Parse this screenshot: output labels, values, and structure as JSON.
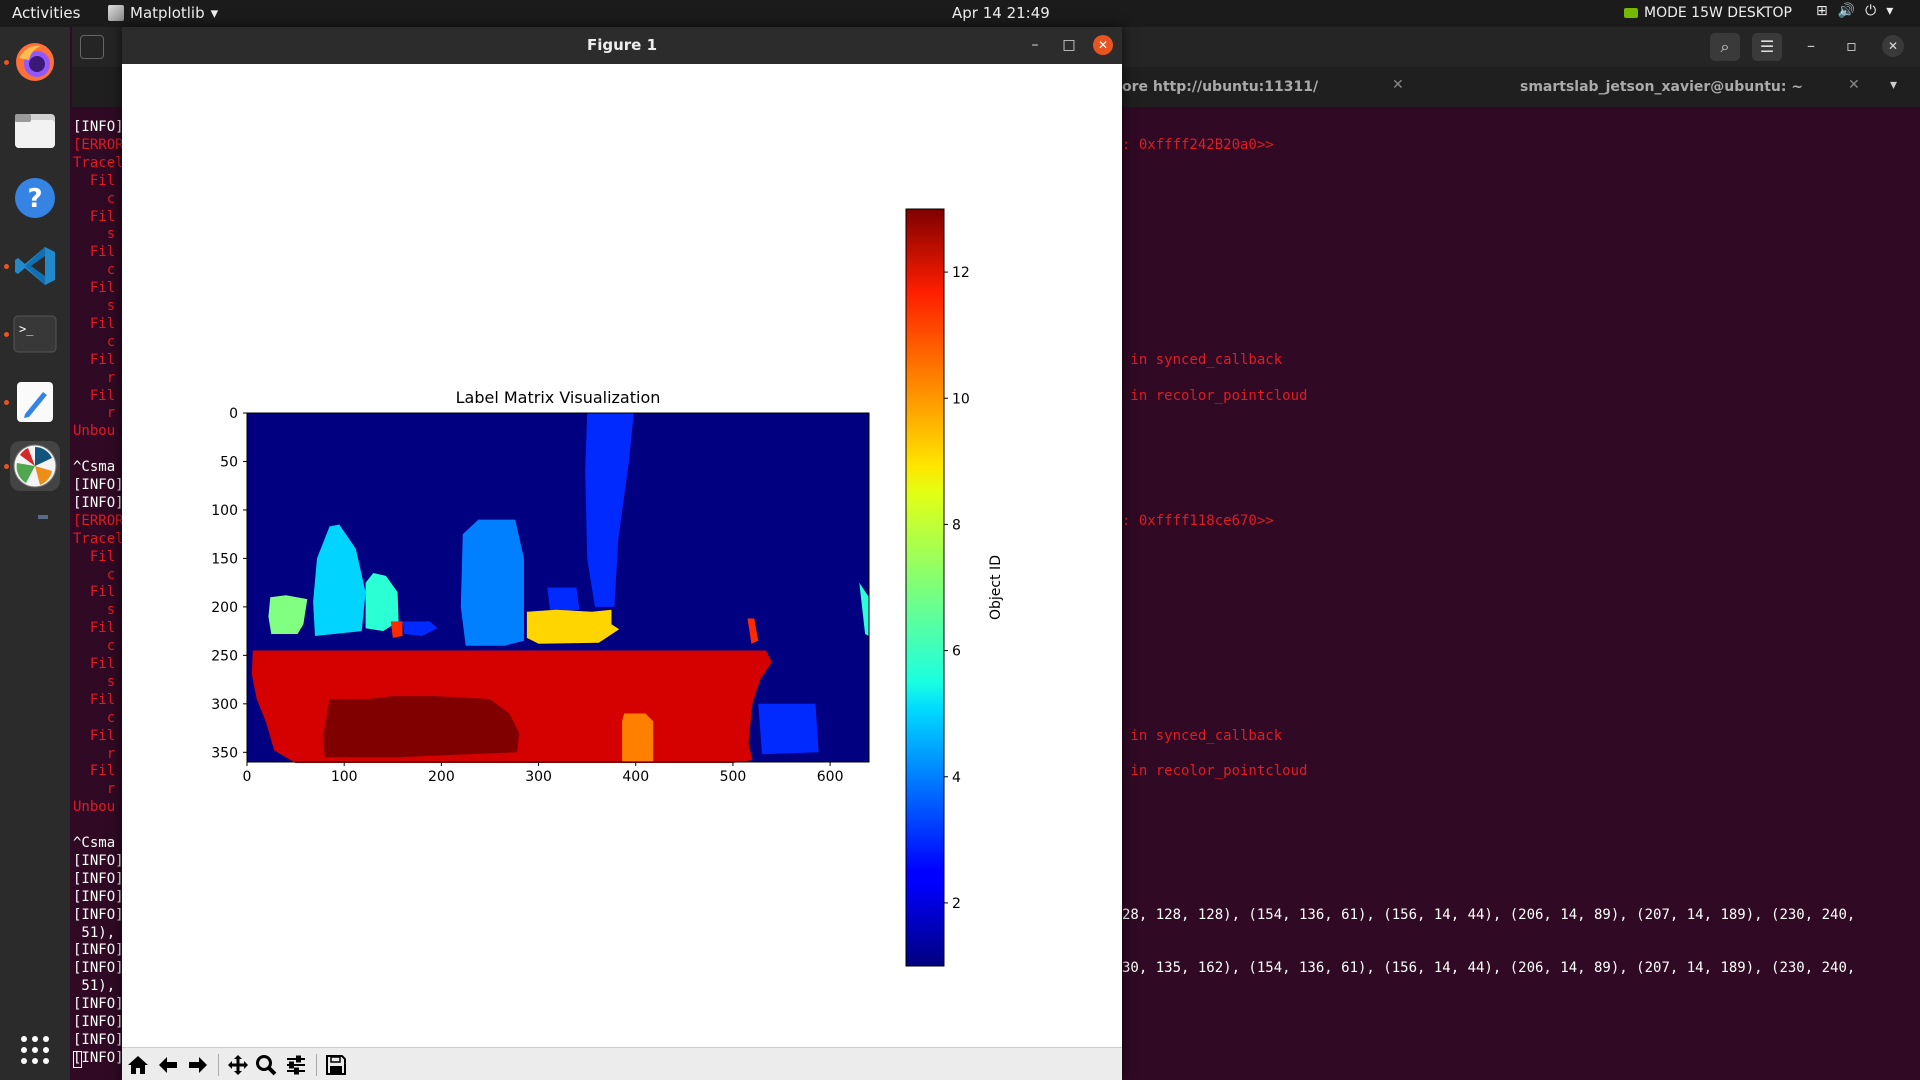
{
  "topbar": {
    "activities": "Activities",
    "app_name": "Matplotlib",
    "clock": "Apr 14  21:49",
    "mode": "MODE 15W DESKTOP"
  },
  "dock": {
    "items": [
      "firefox-icon",
      "files-icon",
      "help-icon",
      "vscode-icon",
      "terminal-icon",
      "text-editor-icon",
      "matplotlib-icon",
      "show-apps-icon"
    ]
  },
  "terminal": {
    "tab1": "ore http://ubuntu:11311/",
    "tab2": "smartslab_jetson_xavier@ubuntu: ~",
    "left_lines": [
      {
        "text": "[INFO]",
        "color": "#ffffff"
      },
      {
        "text": "[ERROR",
        "color": "#e01b24"
      },
      {
        "text": "Tracel",
        "color": "#e01b24"
      },
      {
        "text": "  Fil",
        "color": "#e01b24"
      },
      {
        "text": "    c",
        "color": "#e01b24"
      },
      {
        "text": "  Fil",
        "color": "#e01b24"
      },
      {
        "text": "    s",
        "color": "#e01b24"
      },
      {
        "text": "  Fil",
        "color": "#e01b24"
      },
      {
        "text": "    c",
        "color": "#e01b24"
      },
      {
        "text": "  Fil",
        "color": "#e01b24"
      },
      {
        "text": "    s",
        "color": "#e01b24"
      },
      {
        "text": "  Fil",
        "color": "#e01b24"
      },
      {
        "text": "    c",
        "color": "#e01b24"
      },
      {
        "text": "  Fil",
        "color": "#e01b24"
      },
      {
        "text": "    r",
        "color": "#e01b24"
      },
      {
        "text": "  Fil",
        "color": "#e01b24"
      },
      {
        "text": "    r",
        "color": "#e01b24"
      },
      {
        "text": "Unbou",
        "color": "#e01b24"
      },
      {
        "text": "",
        "color": "#ffffff"
      },
      {
        "text": "^Csma",
        "color": "#ffffff"
      },
      {
        "text": "[INFO]",
        "color": "#ffffff"
      },
      {
        "text": "[INFO]",
        "color": "#ffffff"
      },
      {
        "text": "[ERROR",
        "color": "#e01b24"
      },
      {
        "text": "Tracel",
        "color": "#e01b24"
      },
      {
        "text": "  Fil",
        "color": "#e01b24"
      },
      {
        "text": "    c",
        "color": "#e01b24"
      },
      {
        "text": "  Fil",
        "color": "#e01b24"
      },
      {
        "text": "    s",
        "color": "#e01b24"
      },
      {
        "text": "  Fil",
        "color": "#e01b24"
      },
      {
        "text": "    c",
        "color": "#e01b24"
      },
      {
        "text": "  Fil",
        "color": "#e01b24"
      },
      {
        "text": "    s",
        "color": "#e01b24"
      },
      {
        "text": "  Fil",
        "color": "#e01b24"
      },
      {
        "text": "    c",
        "color": "#e01b24"
      },
      {
        "text": "  Fil",
        "color": "#e01b24"
      },
      {
        "text": "    r",
        "color": "#e01b24"
      },
      {
        "text": "  Fil",
        "color": "#e01b24"
      },
      {
        "text": "    r",
        "color": "#e01b24"
      },
      {
        "text": "Unbou",
        "color": "#e01b24"
      },
      {
        "text": "",
        "color": "#ffffff"
      },
      {
        "text": "^Csma",
        "color": "#ffffff"
      },
      {
        "text": "[INFO]",
        "color": "#ffffff"
      },
      {
        "text": "[INFO]",
        "color": "#ffffff"
      },
      {
        "text": "[INFO]",
        "color": "#ffffff"
      },
      {
        "text": "[INFO]",
        "color": "#ffffff"
      },
      {
        "text": " 51),",
        "color": "#ffffff"
      },
      {
        "text": "[INFO]",
        "color": "#ffffff"
      },
      {
        "text": "[INFO]",
        "color": "#ffffff"
      },
      {
        "text": " 51),",
        "color": "#ffffff"
      },
      {
        "text": "[INFO]",
        "color": "#ffffff"
      },
      {
        "text": "[INFO]",
        "color": "#ffffff"
      },
      {
        "text": "[INFO]",
        "color": "#ffffff"
      },
      {
        "text": "[INFO]",
        "color": "#ffffff"
      }
    ],
    "right_lines": [
      {
        "row": 1,
        "text": ": 0xffff242B20a0>>",
        "color": "#e01b24"
      },
      {
        "row": 13,
        "text": " in synced_callback",
        "color": "#e01b24"
      },
      {
        "row": 15,
        "text": " in recolor_pointcloud",
        "color": "#e01b24"
      },
      {
        "row": 22,
        "text": ": 0xffff118ce670>>",
        "color": "#e01b24"
      },
      {
        "row": 34,
        "text": " in synced_callback",
        "color": "#e01b24"
      },
      {
        "row": 36,
        "text": " in recolor_pointcloud",
        "color": "#e01b24"
      },
      {
        "row": 44,
        "text": "28, 128, 128), (154, 136, 61), (156, 14, 44), (206, 14, 89), (207, 14, 189), (230, 240,",
        "color": "#ffffff"
      },
      {
        "row": 47,
        "text": "30, 135, 162), (154, 136, 61), (156, 14, 44), (206, 14, 89), (207, 14, 189), (230, 240,",
        "color": "#ffffff"
      }
    ]
  },
  "window": {
    "title": "Figure 1",
    "min": "–",
    "max": "□",
    "close": "✕"
  },
  "chart_data": {
    "type": "heatmap",
    "title": "Label Matrix Visualization",
    "xlabel": "",
    "ylabel": "",
    "xlim": [
      0,
      640
    ],
    "ylim": [
      360,
      0
    ],
    "xticks": [
      0,
      100,
      200,
      300,
      400,
      500,
      600
    ],
    "yticks": [
      0,
      50,
      100,
      150,
      200,
      250,
      300,
      350
    ],
    "colormap": "jet",
    "background_value": 1,
    "colorbar": {
      "label": "Object ID",
      "range": [
        1,
        13
      ],
      "ticks": [
        2,
        4,
        6,
        8,
        10,
        12
      ]
    },
    "regions": [
      {
        "value": 3,
        "points": [
          [
            350,
            0
          ],
          [
            398,
            0
          ],
          [
            393,
            50
          ],
          [
            382,
            130
          ],
          [
            378,
            200
          ],
          [
            358,
            200
          ],
          [
            350,
            150
          ],
          [
            348,
            60
          ]
        ]
      },
      {
        "value": 4,
        "points": [
          [
            222,
            125
          ],
          [
            238,
            110
          ],
          [
            276,
            110
          ],
          [
            285,
            150
          ],
          [
            285,
            235
          ],
          [
            265,
            240
          ],
          [
            225,
            240
          ],
          [
            220,
            200
          ]
        ]
      },
      {
        "value": 5,
        "points": [
          [
            72,
            150
          ],
          [
            85,
            117
          ],
          [
            95,
            115
          ],
          [
            112,
            140
          ],
          [
            122,
            185
          ],
          [
            118,
            225
          ],
          [
            70,
            230
          ],
          [
            68,
            195
          ]
        ]
      },
      {
        "value": 7,
        "points": [
          [
            24,
            190
          ],
          [
            40,
            188
          ],
          [
            62,
            192
          ],
          [
            58,
            218
          ],
          [
            52,
            228
          ],
          [
            25,
            228
          ],
          [
            22,
            210
          ]
        ]
      },
      {
        "value": 6,
        "points": [
          [
            122,
            175
          ],
          [
            130,
            165
          ],
          [
            143,
            168
          ],
          [
            155,
            185
          ],
          [
            156,
            215
          ],
          [
            140,
            225
          ],
          [
            122,
            222
          ]
        ]
      },
      {
        "value": 11,
        "points": [
          [
            148,
            215
          ],
          [
            160,
            215
          ],
          [
            160,
            230
          ],
          [
            150,
            232
          ]
        ]
      },
      {
        "value": 3,
        "points": [
          [
            160,
            215
          ],
          [
            188,
            215
          ],
          [
            196,
            222
          ],
          [
            180,
            230
          ],
          [
            162,
            228
          ]
        ]
      },
      {
        "value": 3,
        "points": [
          [
            309,
            180
          ],
          [
            339,
            180
          ],
          [
            342,
            203
          ],
          [
            312,
            205
          ]
        ]
      },
      {
        "value": 9,
        "points": [
          [
            288,
            205
          ],
          [
            318,
            203
          ],
          [
            355,
            205
          ],
          [
            375,
            203
          ],
          [
            375,
            218
          ],
          [
            383,
            223
          ],
          [
            362,
            237
          ],
          [
            300,
            238
          ],
          [
            288,
            232
          ]
        ]
      },
      {
        "value": 11,
        "points": [
          [
            515,
            212
          ],
          [
            522,
            212
          ],
          [
            526,
            235
          ],
          [
            519,
            238
          ]
        ]
      },
      {
        "value": 6,
        "points": [
          [
            630,
            175
          ],
          [
            640,
            190
          ],
          [
            640,
            230
          ],
          [
            636,
            228
          ]
        ]
      },
      {
        "value": 12,
        "points": [
          [
            6,
            245
          ],
          [
            534,
            245
          ],
          [
            540,
            257
          ],
          [
            528,
            275
          ],
          [
            520,
            300
          ],
          [
            516,
            340
          ],
          [
            520,
            358
          ],
          [
            500,
            361
          ],
          [
            428,
            361
          ],
          [
            50,
            361
          ],
          [
            28,
            348
          ],
          [
            20,
            320
          ],
          [
            10,
            295
          ],
          [
            5,
            270
          ]
        ]
      },
      {
        "value": 3,
        "points": [
          [
            526,
            300
          ],
          [
            585,
            300
          ],
          [
            588,
            350
          ],
          [
            530,
            352
          ]
        ]
      },
      {
        "value": 10,
        "points": [
          [
            388,
            310
          ],
          [
            410,
            310
          ],
          [
            418,
            318
          ],
          [
            418,
            360
          ],
          [
            386,
            360
          ],
          [
            386,
            318
          ]
        ]
      },
      {
        "value": 13,
        "points": [
          [
            85,
            295
          ],
          [
            125,
            295
          ],
          [
            150,
            292
          ],
          [
            195,
            292
          ],
          [
            250,
            295
          ],
          [
            270,
            310
          ],
          [
            280,
            330
          ],
          [
            278,
            350
          ],
          [
            155,
            355
          ],
          [
            80,
            355
          ],
          [
            78,
            335
          ]
        ]
      }
    ]
  },
  "toolbar": {
    "buttons": [
      "home-icon",
      "back-icon",
      "forward-icon",
      "pan-icon",
      "zoom-icon",
      "configure-icon",
      "save-icon"
    ]
  }
}
